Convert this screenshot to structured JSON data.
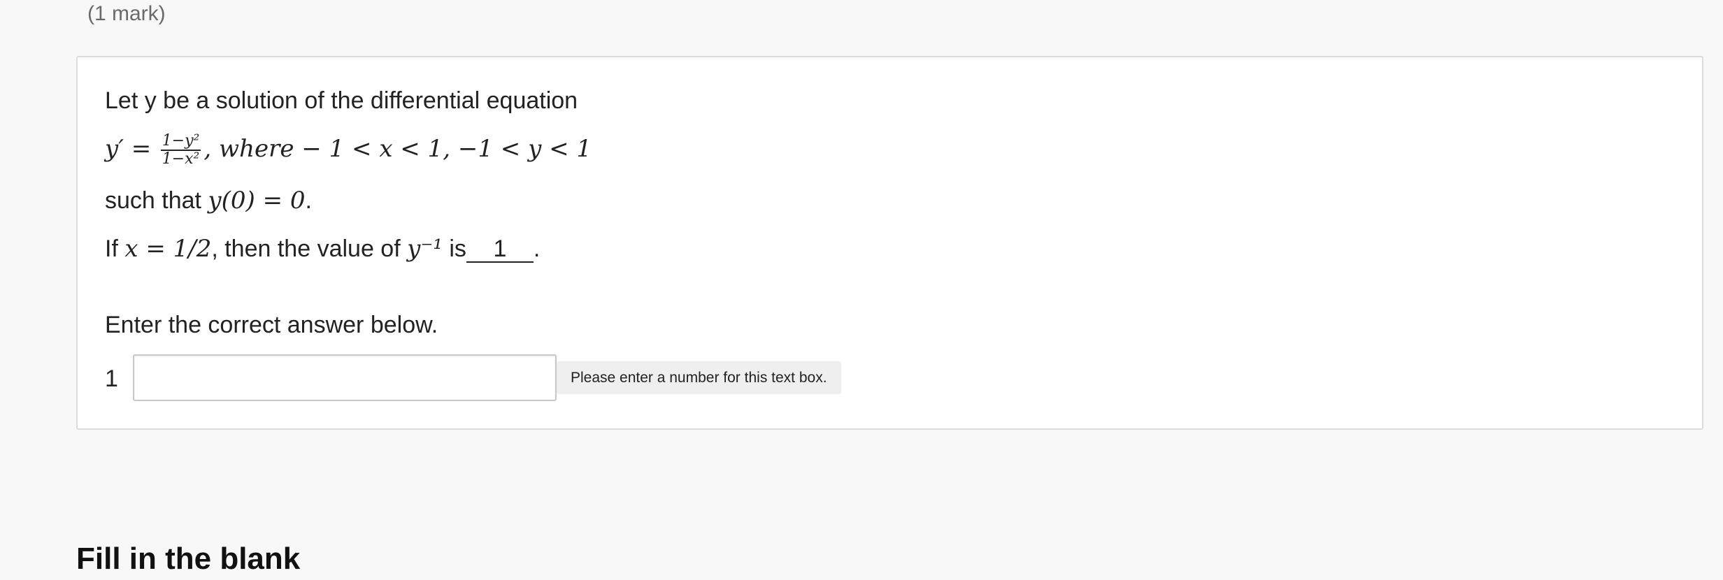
{
  "header": {
    "marks": "(1 mark)"
  },
  "question": {
    "intro": "Let y be a solution of the differential equation",
    "equation": {
      "lhs": "y′ =",
      "frac_num": "1−y²",
      "frac_den": "1−x²",
      "rest": ", where − 1 < x < 1,  −1 < y < 1"
    },
    "condition_prefix": " such that ",
    "condition_math": "y(0) = 0",
    "condition_suffix": ".",
    "ask_prefix": "If ",
    "ask_math": "x = 1/2",
    "ask_middle": ", then the value of ",
    "ask_math2": "y⁻¹",
    "ask_is": " is",
    "blank_label": "1",
    "ask_end": "."
  },
  "answer": {
    "instruction": "Enter the correct answer below.",
    "index": "1",
    "input_value": "",
    "hint": "Please enter a number for this text box."
  },
  "next_section": {
    "heading": "Fill in the blank"
  }
}
